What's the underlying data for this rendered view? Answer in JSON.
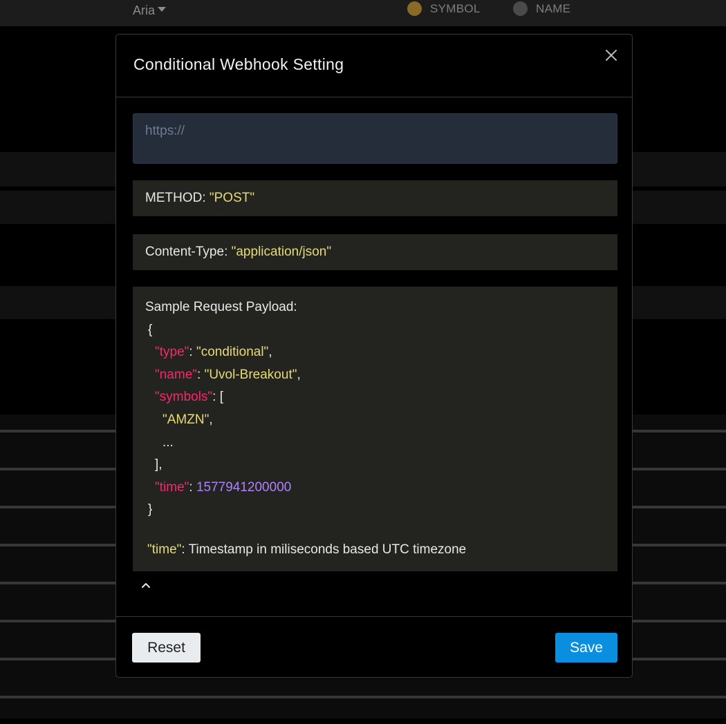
{
  "background": {
    "font_select": "Aria",
    "radios": [
      {
        "label": "SYMBOL",
        "color": "#8a6a24"
      },
      {
        "label": "NAME",
        "color": "#4a4a4a"
      }
    ]
  },
  "modal": {
    "title": "Conditional Webhook Setting",
    "url_placeholder": "https://",
    "method_label": "METHOD: ",
    "method_value": "\"POST\"",
    "content_type_label": "Content-Type: ",
    "content_type_value": "\"application/json\"",
    "payload": {
      "heading": "Sample Request Payload:",
      "open_brace": "{",
      "type_key": "\"type\"",
      "type_value": "\"conditional\"",
      "name_key": "\"name\"",
      "name_value": "\"Uvol-Breakout\"",
      "symbols_key": "\"symbols\"",
      "symbols_open": "[",
      "symbol_item": "\"AMZN\"",
      "ellipsis": "...",
      "symbols_close": "],",
      "time_key": "\"time\"",
      "time_value": "1577941200000",
      "close_brace": "}",
      "note_key": "\"time\"",
      "note_text": ": Timestamp in miliseconds based UTC timezone"
    },
    "reset_label": "Reset",
    "save_label": "Save"
  },
  "colors": {
    "accent": "#0a8fe0",
    "string": "#e6db74",
    "key": "#f92672",
    "number": "#ae81ff"
  }
}
